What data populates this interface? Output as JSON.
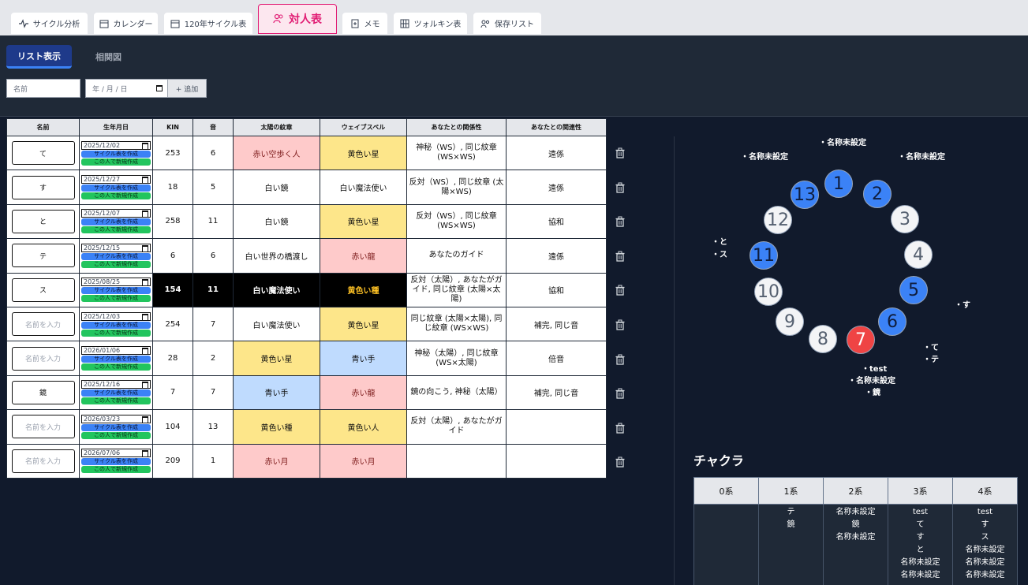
{
  "tabs": [
    {
      "label": "サイクル分析",
      "icon": "pulse-icon",
      "active": false
    },
    {
      "label": "カレンダー",
      "icon": "calendar-icon",
      "active": false
    },
    {
      "label": "120年サイクル表",
      "icon": "calendar-icon",
      "active": false
    },
    {
      "label": "対人表",
      "icon": "users-icon",
      "active": true
    },
    {
      "label": "メモ",
      "icon": "note-icon",
      "active": false
    },
    {
      "label": "ツォルキン表",
      "icon": "grid-icon",
      "active": false
    },
    {
      "label": "保存リスト",
      "icon": "users-icon",
      "active": false
    }
  ],
  "subtabs": {
    "list": "リスト表示",
    "graph": "相関図"
  },
  "form": {
    "name_placeholder": "名前",
    "date_placeholder": "年 / 月 / 日",
    "add_label": "+ 追加"
  },
  "table": {
    "headers": [
      "名前",
      "生年月日",
      "KIN",
      "音",
      "太陽の紋章",
      "ウェイブスペル",
      "あなたとの関係性",
      "あなたとの関連性"
    ],
    "cycle_button": "サイクル表を作成",
    "new_button": "この人で新規作成",
    "name_placeholder": "名前を入力",
    "rows": [
      {
        "name": "て",
        "date": "2025/12/02",
        "kin": "253",
        "tone": "6",
        "seal": "赤い空歩く人",
        "wave": "黄色い星",
        "rel": "神秘（WS）, 同じ紋章 (WS×WS)",
        "near": "遠係"
      },
      {
        "name": "す",
        "date": "2025/12/27",
        "kin": "18",
        "tone": "5",
        "seal": "白い鏡",
        "wave": "白い魔法使い",
        "rel": "反対（WS）, 同じ紋章 (太陽×WS)",
        "near": "遠係"
      },
      {
        "name": "と",
        "date": "2025/12/07",
        "kin": "258",
        "tone": "11",
        "seal": "白い鏡",
        "wave": "黄色い星",
        "rel": "反対（WS）, 同じ紋章 (WS×WS)",
        "near": "協和"
      },
      {
        "name": "テ",
        "date": "2025/12/15",
        "kin": "6",
        "tone": "6",
        "seal": "白い世界の橋渡し",
        "wave": "赤い龍",
        "rel": "あなたのガイド",
        "near": "遠係"
      },
      {
        "name": "ス",
        "date": "2025/08/25",
        "kin": "154",
        "tone": "11",
        "seal": "白い魔法使い",
        "wave": "黄色い種",
        "rel": "反対（太陽）, あなたがガイド, 同じ紋章 (太陽×太陽)",
        "near": "協和"
      },
      {
        "name": "",
        "date": "2025/12/03",
        "kin": "254",
        "tone": "7",
        "seal": "白い魔法使い",
        "wave": "黄色い星",
        "rel": "同じ紋章 (太陽×太陽), 同じ紋章 (WS×WS)",
        "near": "補完, 同じ音"
      },
      {
        "name": "",
        "date": "2026/01/06",
        "kin": "28",
        "tone": "2",
        "seal": "黄色い星",
        "wave": "青い手",
        "rel": "神秘（太陽）, 同じ紋章 (WS×太陽)",
        "near": "倍音"
      },
      {
        "name": "鏡",
        "date": "2025/12/16",
        "kin": "7",
        "tone": "7",
        "seal": "青い手",
        "wave": "赤い龍",
        "rel": "鏡の向こう, 神秘（太陽）",
        "near": "補完, 同じ音"
      },
      {
        "name": "",
        "date": "2026/03/23",
        "kin": "104",
        "tone": "13",
        "seal": "黄色い種",
        "wave": "黄色い人",
        "rel": "反対（太陽）, あなたがガイド",
        "near": ""
      },
      {
        "name": "",
        "date": "2026/07/06",
        "kin": "209",
        "tone": "1",
        "seal": "赤い月",
        "wave": "赤い月",
        "rel": "",
        "near": ""
      }
    ]
  },
  "colors": {
    "red_seal": "#fecaca",
    "yellow_seal": "#fde68a",
    "blue_seal": "#bfdbfe",
    "white_seal": "#ffffff",
    "highlight_row": "#000000",
    "accent": "#e11d74"
  },
  "wheel": {
    "tones": [
      "1",
      "2",
      "3",
      "4",
      "5",
      "6",
      "7",
      "8",
      "9",
      "10",
      "11",
      "12",
      "13"
    ],
    "labels": [
      "・名称未設定",
      "・名称未設定",
      "・名称未設定",
      "・と",
      "・ス",
      "・す",
      "・て",
      "・テ",
      "・test",
      "・名称未設定",
      "・鏡"
    ]
  },
  "chakra": {
    "title": "チャクラ",
    "headers": [
      "0系",
      "1系",
      "2系",
      "3系",
      "4系"
    ],
    "cols": [
      [],
      [
        "テ",
        "鏡"
      ],
      [
        "名称未設定",
        "鏡",
        "名称未設定"
      ],
      [
        "test",
        "て",
        "す",
        "と",
        "名称未設定",
        "名称未設定"
      ],
      [
        "test",
        "す",
        "ス",
        "名称未設定",
        "名称未設定",
        "名称未設定"
      ]
    ]
  }
}
